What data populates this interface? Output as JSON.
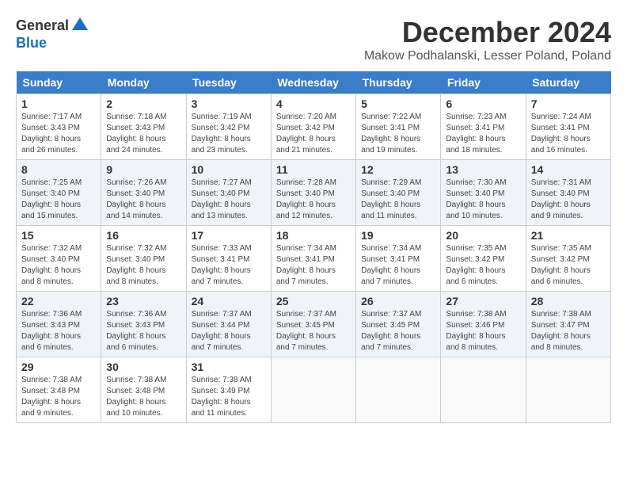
{
  "logo": {
    "general": "General",
    "blue": "Blue"
  },
  "title": {
    "month": "December 2024",
    "location": "Makow Podhalanski, Lesser Poland, Poland"
  },
  "headers": [
    "Sunday",
    "Monday",
    "Tuesday",
    "Wednesday",
    "Thursday",
    "Friday",
    "Saturday"
  ],
  "weeks": [
    [
      {
        "day": "1",
        "sunrise": "7:17 AM",
        "sunset": "3:43 PM",
        "daylight": "8 hours and 26 minutes."
      },
      {
        "day": "2",
        "sunrise": "7:18 AM",
        "sunset": "3:43 PM",
        "daylight": "8 hours and 24 minutes."
      },
      {
        "day": "3",
        "sunrise": "7:19 AM",
        "sunset": "3:42 PM",
        "daylight": "8 hours and 23 minutes."
      },
      {
        "day": "4",
        "sunrise": "7:20 AM",
        "sunset": "3:42 PM",
        "daylight": "8 hours and 21 minutes."
      },
      {
        "day": "5",
        "sunrise": "7:22 AM",
        "sunset": "3:41 PM",
        "daylight": "8 hours and 19 minutes."
      },
      {
        "day": "6",
        "sunrise": "7:23 AM",
        "sunset": "3:41 PM",
        "daylight": "8 hours and 18 minutes."
      },
      {
        "day": "7",
        "sunrise": "7:24 AM",
        "sunset": "3:41 PM",
        "daylight": "8 hours and 16 minutes."
      }
    ],
    [
      {
        "day": "8",
        "sunrise": "7:25 AM",
        "sunset": "3:40 PM",
        "daylight": "8 hours and 15 minutes."
      },
      {
        "day": "9",
        "sunrise": "7:26 AM",
        "sunset": "3:40 PM",
        "daylight": "8 hours and 14 minutes."
      },
      {
        "day": "10",
        "sunrise": "7:27 AM",
        "sunset": "3:40 PM",
        "daylight": "8 hours and 13 minutes."
      },
      {
        "day": "11",
        "sunrise": "7:28 AM",
        "sunset": "3:40 PM",
        "daylight": "8 hours and 12 minutes."
      },
      {
        "day": "12",
        "sunrise": "7:29 AM",
        "sunset": "3:40 PM",
        "daylight": "8 hours and 11 minutes."
      },
      {
        "day": "13",
        "sunrise": "7:30 AM",
        "sunset": "3:40 PM",
        "daylight": "8 hours and 10 minutes."
      },
      {
        "day": "14",
        "sunrise": "7:31 AM",
        "sunset": "3:40 PM",
        "daylight": "8 hours and 9 minutes."
      }
    ],
    [
      {
        "day": "15",
        "sunrise": "7:32 AM",
        "sunset": "3:40 PM",
        "daylight": "8 hours and 8 minutes."
      },
      {
        "day": "16",
        "sunrise": "7:32 AM",
        "sunset": "3:40 PM",
        "daylight": "8 hours and 8 minutes."
      },
      {
        "day": "17",
        "sunrise": "7:33 AM",
        "sunset": "3:41 PM",
        "daylight": "8 hours and 7 minutes."
      },
      {
        "day": "18",
        "sunrise": "7:34 AM",
        "sunset": "3:41 PM",
        "daylight": "8 hours and 7 minutes."
      },
      {
        "day": "19",
        "sunrise": "7:34 AM",
        "sunset": "3:41 PM",
        "daylight": "8 hours and 7 minutes."
      },
      {
        "day": "20",
        "sunrise": "7:35 AM",
        "sunset": "3:42 PM",
        "daylight": "8 hours and 6 minutes."
      },
      {
        "day": "21",
        "sunrise": "7:35 AM",
        "sunset": "3:42 PM",
        "daylight": "8 hours and 6 minutes."
      }
    ],
    [
      {
        "day": "22",
        "sunrise": "7:36 AM",
        "sunset": "3:43 PM",
        "daylight": "8 hours and 6 minutes."
      },
      {
        "day": "23",
        "sunrise": "7:36 AM",
        "sunset": "3:43 PM",
        "daylight": "8 hours and 6 minutes."
      },
      {
        "day": "24",
        "sunrise": "7:37 AM",
        "sunset": "3:44 PM",
        "daylight": "8 hours and 7 minutes."
      },
      {
        "day": "25",
        "sunrise": "7:37 AM",
        "sunset": "3:45 PM",
        "daylight": "8 hours and 7 minutes."
      },
      {
        "day": "26",
        "sunrise": "7:37 AM",
        "sunset": "3:45 PM",
        "daylight": "8 hours and 7 minutes."
      },
      {
        "day": "27",
        "sunrise": "7:38 AM",
        "sunset": "3:46 PM",
        "daylight": "8 hours and 8 minutes."
      },
      {
        "day": "28",
        "sunrise": "7:38 AM",
        "sunset": "3:47 PM",
        "daylight": "8 hours and 8 minutes."
      }
    ],
    [
      {
        "day": "29",
        "sunrise": "7:38 AM",
        "sunset": "3:48 PM",
        "daylight": "8 hours and 9 minutes."
      },
      {
        "day": "30",
        "sunrise": "7:38 AM",
        "sunset": "3:48 PM",
        "daylight": "8 hours and 10 minutes."
      },
      {
        "day": "31",
        "sunrise": "7:38 AM",
        "sunset": "3:49 PM",
        "daylight": "8 hours and 11 minutes."
      },
      null,
      null,
      null,
      null
    ]
  ]
}
